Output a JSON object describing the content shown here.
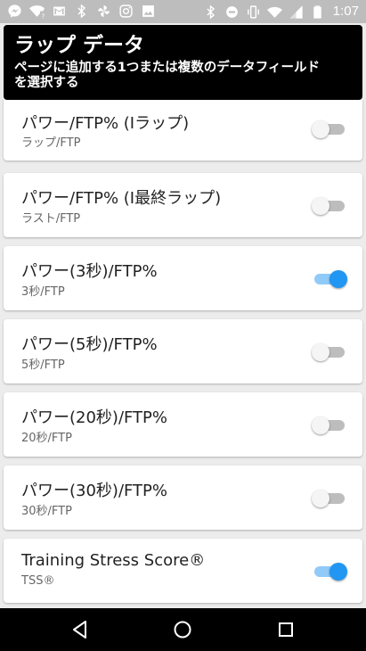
{
  "status_bar": {
    "time": "1:07",
    "left_icons": [
      "messenger-icon",
      "wifi-question-icon",
      "gmail-icon",
      "bluetooth-icon",
      "pinwheel-icon",
      "instagram-icon",
      "image-icon"
    ],
    "right_icons": [
      "bluetooth-icon",
      "do-not-disturb-icon",
      "vibrate-icon",
      "wifi-icon",
      "signal-icon",
      "battery-icon"
    ]
  },
  "header": {
    "title": "ラップ データ",
    "subtitle_line1": "ページに追加する1つまたは複数のデータフィールド",
    "subtitle_line2": "を選択する"
  },
  "fields": [
    {
      "title": "パワー/FTP% (Iラップ)",
      "subtitle": "ラップ/FTP",
      "enabled": false
    },
    {
      "title": "パワー/FTP% (I最終ラップ)",
      "subtitle": "ラスト/FTP",
      "enabled": false
    },
    {
      "title": "パワー(3秒)/FTP%",
      "subtitle": "3秒/FTP",
      "enabled": true
    },
    {
      "title": "パワー(5秒)/FTP%",
      "subtitle": "5秒/FTP",
      "enabled": false
    },
    {
      "title": "パワー(20秒)/FTP%",
      "subtitle": "20秒/FTP",
      "enabled": false
    },
    {
      "title": "パワー(30秒)/FTP%",
      "subtitle": "30秒/FTP",
      "enabled": false
    },
    {
      "title": "Training Stress Score®",
      "subtitle": "TSS®",
      "enabled": true
    }
  ],
  "colors": {
    "header_bg": "#000000",
    "toggle_on": "#2196f3",
    "toggle_off": "#bdbdbd"
  }
}
